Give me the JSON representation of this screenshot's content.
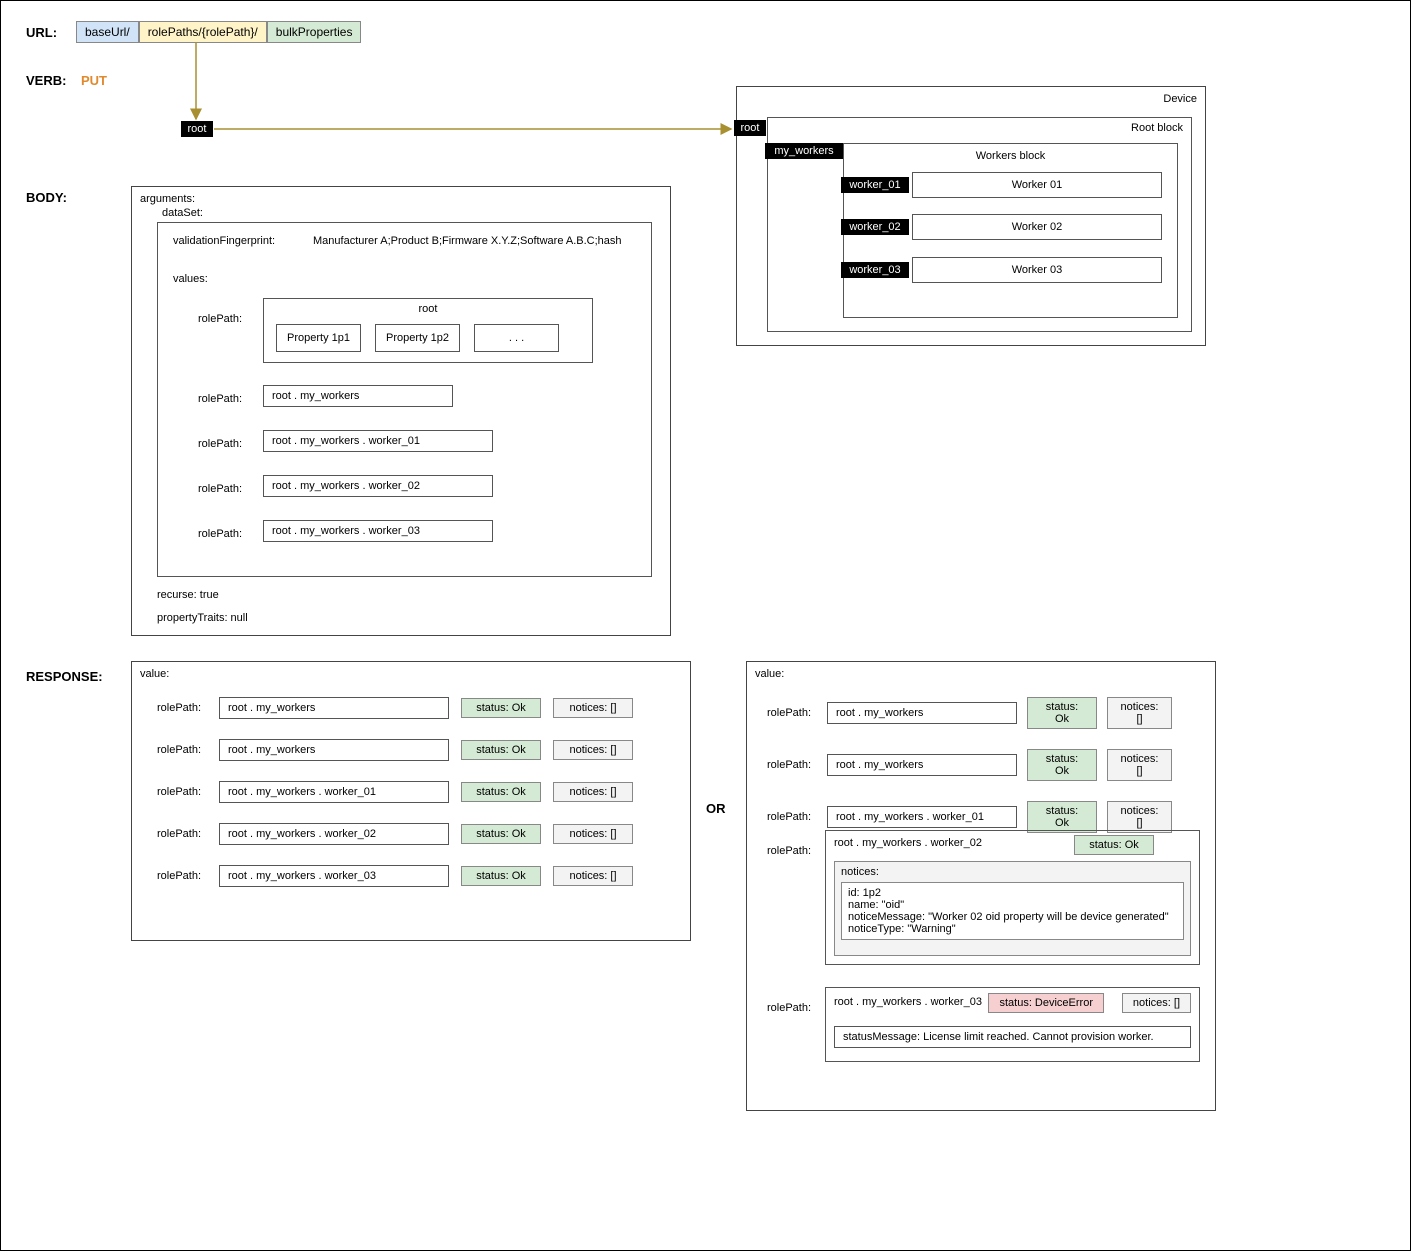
{
  "url": {
    "label": "URL:",
    "seg1": "baseUrl/",
    "seg2": "rolePaths/{rolePath}/",
    "seg3": "bulkProperties"
  },
  "verb": {
    "label": "VERB:",
    "value": "PUT"
  },
  "body": {
    "label": "BODY:"
  },
  "response": {
    "label": "RESPONSE:"
  },
  "or": "OR",
  "root": "root",
  "device": {
    "title": "Device",
    "rootBlock": "Root block",
    "myWorkers": "my_workers",
    "workersBlock": "Workers block",
    "w1": {
      "k": "worker_01",
      "t": "Worker 01"
    },
    "w2": {
      "k": "worker_02",
      "t": "Worker 02"
    },
    "w3": {
      "k": "worker_03",
      "t": "Worker 03"
    }
  },
  "args": {
    "arguments": "arguments:",
    "dataSet": "dataSet:",
    "fp_label": "validationFingerprint:",
    "fp_value": "Manufacturer A;Product B;Firmware X.Y.Z;Software A.B.C;hash",
    "values": "values:",
    "rolePath": "rolePath:",
    "rootBox": "root",
    "p1": "Property 1p1",
    "p2": "Property 1p2",
    "dots": ". . .",
    "rp1": "root . my_workers",
    "rp2": "root . my_workers . worker_01",
    "rp3": "root . my_workers . worker_02",
    "rp4": "root . my_workers . worker_03",
    "recurse": "recurse: true",
    "traits": "propertyTraits: null"
  },
  "resp": {
    "value": "value:",
    "rolePath": "rolePath:",
    "statusOk": "status: Ok",
    "notices": "notices: []",
    "rows": [
      "root . my_workers",
      "root . my_workers",
      "root . my_workers . worker_01",
      "root . my_workers . worker_02",
      "root . my_workers . worker_03"
    ]
  },
  "resp2": {
    "value": "value:",
    "rolePath": "rolePath:",
    "statusOk": "status: Ok",
    "statusErr": "status: DeviceError",
    "notices": "notices: []",
    "noticesHdr": "notices:",
    "r1": "root . my_workers",
    "r2": "root . my_workers",
    "r3": "root . my_workers . worker_01",
    "r4": "root . my_workers . worker_02",
    "r5": "root . my_workers . worker_03",
    "n_id": "id: 1p2",
    "n_name": "name: \"oid\"",
    "n_msg": "noticeMessage: \"Worker 02 oid property will be device generated\"",
    "n_type": "noticeType: \"Warning\"",
    "statusMsg": "statusMessage: License limit reached. Cannot provision worker."
  }
}
